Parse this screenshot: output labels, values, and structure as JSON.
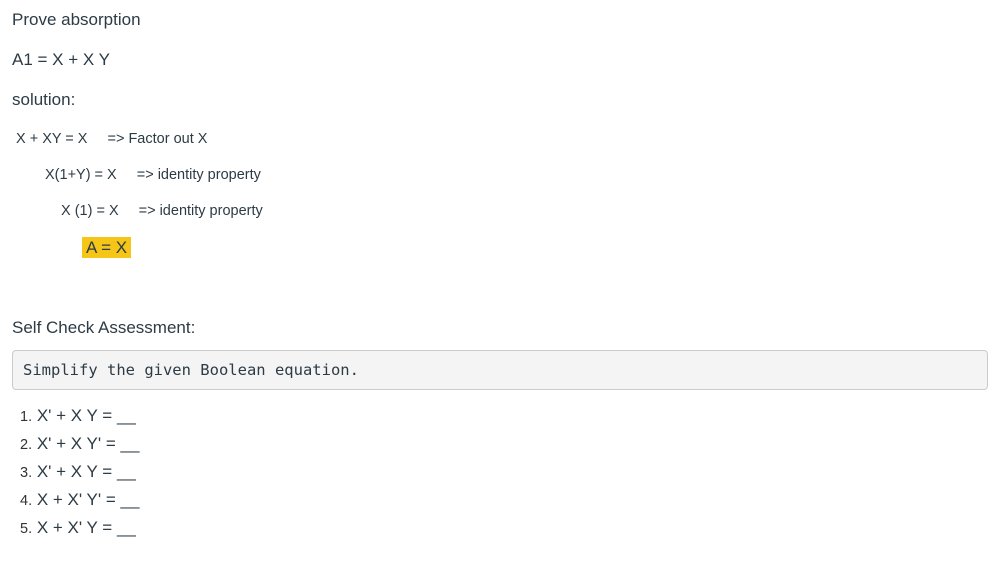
{
  "title": "Prove absorption",
  "equation": "A1 = X + X Y",
  "solution_label": "solution:",
  "steps": [
    {
      "expr": "X + XY = X",
      "note": "=> Factor out X"
    },
    {
      "expr": "X(1+Y) = X",
      "note": "=> identity property"
    },
    {
      "expr": "X (1) = X",
      "note": "=> identity property"
    }
  ],
  "result": "A = X",
  "self_check": {
    "heading": "Self Check Assessment:",
    "instruction": "Simplify the given Boolean equation.",
    "questions": [
      {
        "num": "1.",
        "text": "X' + X Y = __"
      },
      {
        "num": "2.",
        "text": "X' + X Y' = __"
      },
      {
        "num": "3.",
        "text": "X' + X Y = __"
      },
      {
        "num": "4.",
        "text": "X + X' Y' = __"
      },
      {
        "num": "5.",
        "text": "X + X' Y = __"
      }
    ]
  },
  "colors": {
    "highlight": "#f5c518",
    "text": "#2d3b45"
  }
}
